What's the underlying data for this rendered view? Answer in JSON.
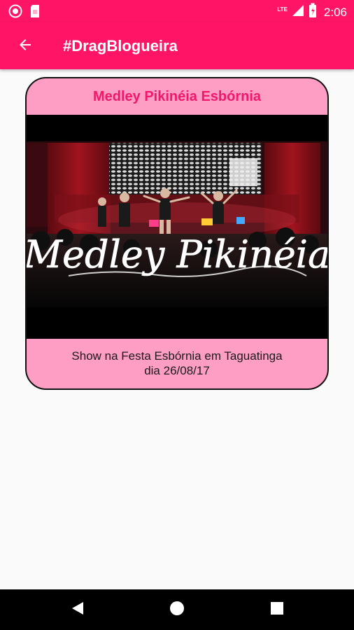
{
  "status_bar": {
    "time": "2:06",
    "network_type": "LTE",
    "icons": [
      "notification-app-icon",
      "sim-card-icon",
      "signal-icon",
      "battery-icon"
    ]
  },
  "app_bar": {
    "title": "#DragBlogueira",
    "back_icon": "arrow-back-icon"
  },
  "card": {
    "title": "Medley Pikinéia Esbórnia",
    "image_overlay_text": "Medley Pikinéia",
    "description_line1": "Show na Festa Esbórnia em Taguatinga",
    "description_line2": "dia 26/08/17"
  },
  "nav_bar": {
    "buttons": [
      "back-triangle-icon",
      "home-circle-icon",
      "recents-square-icon"
    ]
  },
  "colors": {
    "primary": "#FF1466",
    "card_background": "#FF9EC4",
    "card_title": "#F0186A",
    "background": "#FAFAFA"
  }
}
